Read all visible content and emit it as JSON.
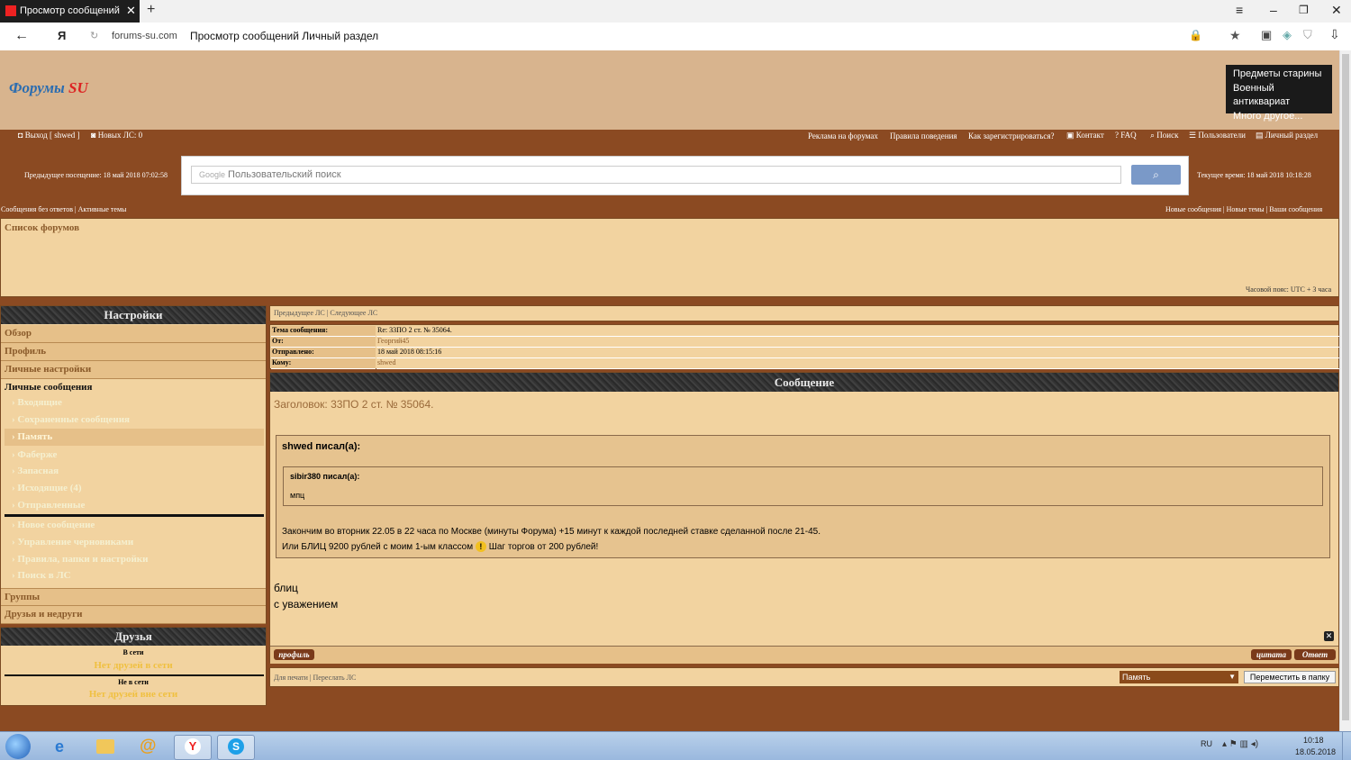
{
  "browser": {
    "tab_title": "Просмотр сообщений Л",
    "url_domain": "forums-su.com",
    "url_title": "Просмотр сообщений Личный раздел"
  },
  "header": {
    "logo_main": "Форумы ",
    "logo_accent": "SU",
    "ad_lines": [
      "Предметы старины",
      "Военный антиквариат",
      "Много другое..."
    ]
  },
  "topnav": {
    "logout": "Выход [ shwed ]",
    "new_pm": "Новых ЛС: 0",
    "right_links": [
      "Реклама на форумах",
      "Правила поведения",
      "Как зарегистрироваться?",
      "Контакт",
      "FAQ",
      "Поиск",
      "Пользователи",
      "Личный раздел"
    ]
  },
  "search": {
    "prev_visit": "Предыдущее посещение: 18 май 2018 07:02:58",
    "brand": "Google",
    "placeholder": "Пользовательский поиск",
    "current_time": "Текущее время: 18 май 2018 10:18:28"
  },
  "subnav": {
    "left": "Сообщения без ответов  |  Активные темы",
    "right": "Новые сообщения | Новые темы  |  Ваши сообщения"
  },
  "breadcrumb": {
    "title": "Список форумов",
    "timezone": "Часовой пояс: UTC + 3 часа"
  },
  "sidebar": {
    "title": "Настройки",
    "top_items": [
      "Обзор",
      "Профиль",
      "Личные настройки"
    ],
    "pm_section": "Личные сообщения",
    "folders": [
      "Входящие",
      "Сохраненные сообщения",
      "Память",
      "Фаберже",
      "Запасная",
      "Исходящие (4)",
      "Отправленные"
    ],
    "actions": [
      "Новое сообщение",
      "Управление черновиками",
      "Правила, папки и настройки",
      "Поиск в ЛС"
    ],
    "bottom_items": [
      "Группы",
      "Друзья и недруги"
    ]
  },
  "friends": {
    "title": "Друзья",
    "online_label": "В сети",
    "online_empty": "Нет друзей в сети",
    "offline_label": "Не в сети",
    "offline_empty": "Нет друзей вне сети"
  },
  "message": {
    "nav": "Предыдущее ЛС  |  Следующее ЛС",
    "fields": [
      {
        "k": "Тема сообщения:",
        "v": "Re: 33ПО 2 ст. № 35064."
      },
      {
        "k": "От:",
        "v": "Георгий45"
      },
      {
        "k": "Отправлено:",
        "v": "18 май 2018 08:15:16"
      },
      {
        "k": "Кому:",
        "v": "shwed"
      }
    ],
    "section_title": "Сообщение",
    "heading": "Заголовок: 33ПО 2 ст. № 35064.",
    "outer_quote_author": "shwed писал(а):",
    "inner_quote_author": "sibir380 писал(а):",
    "inner_quote_text": "мпц",
    "quote_line1": "Закончим во вторник 22.05 в 22 часа по Москве (минуты Форума) +15 минут к каждой последней ставке сделанной после 21-45.",
    "quote_line2a": "Или БЛИЦ 9200 рублей с моим 1-ым классом",
    "quote_line2b": "Шаг торгов от 200 рублей!",
    "reply_line1": "блиц",
    "reply_line2": "с уважением",
    "btn_profile": "профиль",
    "btn_quote": "цитата",
    "btn_reply": "Ответ"
  },
  "footer": {
    "links": "Для печати  |  Переслать ЛС",
    "folder_select": "Память",
    "move_button": "Переместить в папку"
  },
  "taskbar": {
    "lang": "RU",
    "time": "10:18",
    "date": "18.05.2018"
  }
}
